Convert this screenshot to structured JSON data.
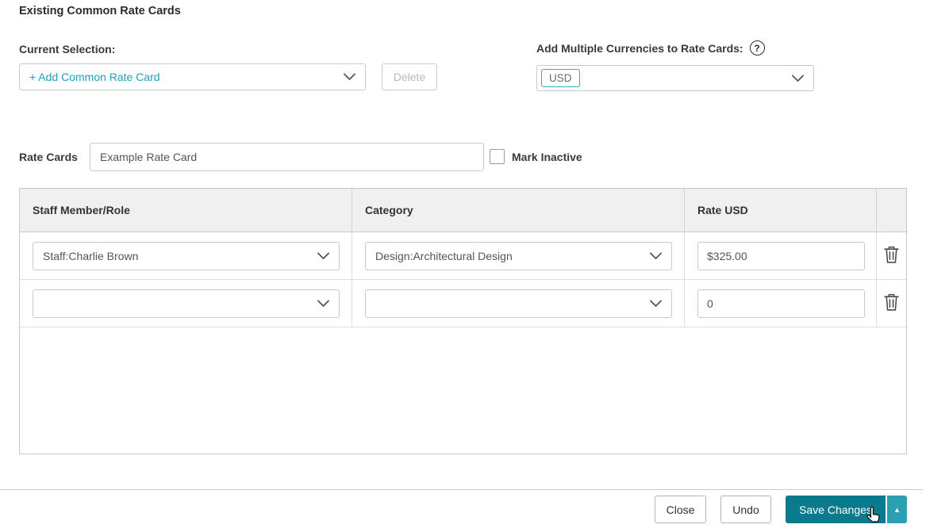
{
  "colors": {
    "accent_teal": "#1f9fba",
    "chip_border_teal": "#35b0c0",
    "save_button_bg": "#0c7a8d",
    "save_more_bg": "#2d9fb3",
    "table_header_bg": "#f0f0f0",
    "border_gray": "#c9c9c9",
    "text_dark": "#333333",
    "disabled_text": "#b9b9b9"
  },
  "header": {
    "title": "Existing Common Rate Cards"
  },
  "selection": {
    "label": "Current Selection:",
    "dropdown_value": "+ Add Common Rate Card",
    "delete_label": "Delete"
  },
  "currencies": {
    "label": "Add Multiple Currencies to Rate Cards:",
    "help_glyph": "?",
    "selected": "USD"
  },
  "rate_card": {
    "label": "Rate Cards",
    "name_value": "Example Rate Card",
    "mark_inactive_label": "Mark Inactive"
  },
  "table": {
    "headers": [
      "Staff Member/Role",
      "Category",
      "Rate USD"
    ],
    "rows": [
      {
        "staff": "Staff:Charlie Brown",
        "category": "Design:Architectural Design",
        "rate": "$325.00"
      },
      {
        "staff": "",
        "category": "",
        "rate": "0"
      }
    ]
  },
  "footer": {
    "close_label": "Close",
    "undo_label": "Undo",
    "save_label": "Save Changes",
    "save_menu_glyph": "▲"
  }
}
